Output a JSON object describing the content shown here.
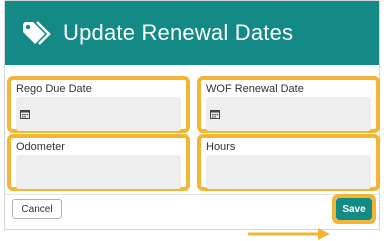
{
  "modal": {
    "title": "Update Renewal Dates",
    "header_color": "#138a85",
    "icon": "tag-icon"
  },
  "fields": {
    "rego_due_date": {
      "label": "Rego Due Date",
      "value": "",
      "icon": "calendar-icon"
    },
    "wof_renewal_date": {
      "label": "WOF Renewal Date",
      "value": "",
      "icon": "calendar-icon"
    },
    "odometer": {
      "label": "Odometer",
      "value": ""
    },
    "hours": {
      "label": "Hours",
      "value": ""
    }
  },
  "footer": {
    "cancel_label": "Cancel",
    "save_label": "Save"
  },
  "annotation": {
    "highlight_color": "#f2b534",
    "arrow_target": "save-button"
  }
}
